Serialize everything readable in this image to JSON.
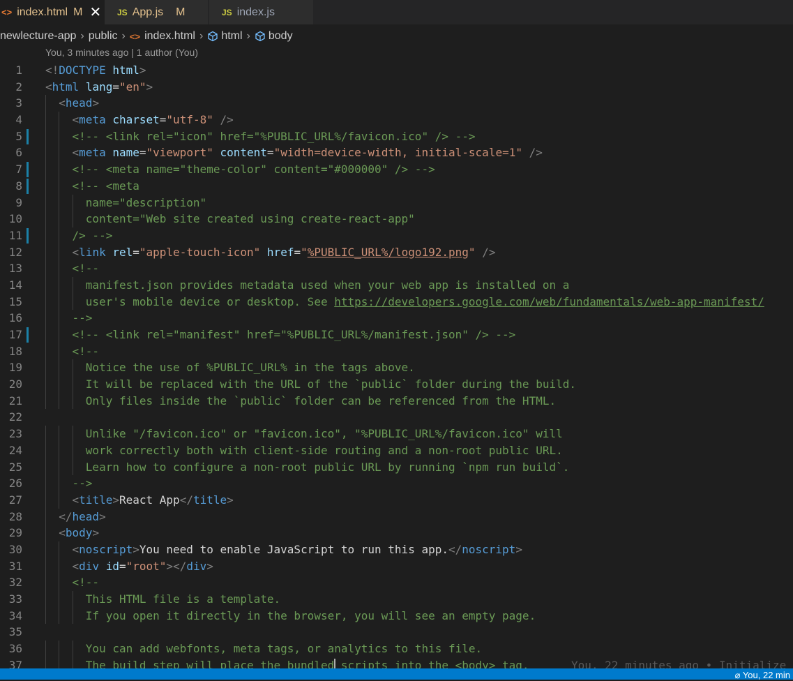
{
  "tabs": [
    {
      "label": "index.html",
      "status": "M",
      "icon": "html-file-icon"
    },
    {
      "label": "App.js",
      "status": "M",
      "icon": "js-file-icon"
    },
    {
      "label": "index.js",
      "status": "",
      "icon": "js-file-icon"
    }
  ],
  "tab_icon_text": {
    "html": "<>",
    "js": "JS"
  },
  "breadcrumb": [
    "newlecture-app",
    "public",
    "index.html",
    "html",
    "body"
  ],
  "codelens": "You, 3 minutes ago | 1 author (You)",
  "ghost_blame": "You, 22 minutes ago • Initialize",
  "status_bar": {
    "blame": "You, 22 min"
  },
  "lines": [
    {
      "n": "1",
      "code": "<!DOCTYPE html>"
    },
    {
      "n": "2",
      "code": "<html lang=\"en\">"
    },
    {
      "n": "3",
      "code": "  <head>"
    },
    {
      "n": "4",
      "code": "    <meta charset=\"utf-8\" />"
    },
    {
      "n": "5",
      "code": "    <!-- <link rel=\"icon\" href=\"%PUBLIC_URL%/favicon.ico\" /> -->",
      "changed": true
    },
    {
      "n": "6",
      "code": "    <meta name=\"viewport\" content=\"width=device-width, initial-scale=1\" />"
    },
    {
      "n": "7",
      "code": "    <!-- <meta name=\"theme-color\" content=\"#000000\" /> -->",
      "changed": true
    },
    {
      "n": "8",
      "code": "    <!-- <meta",
      "changed": true
    },
    {
      "n": "9",
      "code": "      name=\"description\""
    },
    {
      "n": "10",
      "code": "      content=\"Web site created using create-react-app\""
    },
    {
      "n": "11",
      "code": "    /> -->",
      "changed": true
    },
    {
      "n": "12",
      "code": "    <link rel=\"apple-touch-icon\" href=\"%PUBLIC_URL%/logo192.png\" />"
    },
    {
      "n": "13",
      "code": "    <!--"
    },
    {
      "n": "14",
      "code": "      manifest.json provides metadata used when your web app is installed on a"
    },
    {
      "n": "15",
      "code": "      user's mobile device or desktop. See https://developers.google.com/web/fundamentals/web-app-manifest/"
    },
    {
      "n": "16",
      "code": "    -->"
    },
    {
      "n": "17",
      "code": "    <!-- <link rel=\"manifest\" href=\"%PUBLIC_URL%/manifest.json\" /> -->",
      "changed": true
    },
    {
      "n": "18",
      "code": "    <!--"
    },
    {
      "n": "19",
      "code": "      Notice the use of %PUBLIC_URL% in the tags above."
    },
    {
      "n": "20",
      "code": "      It will be replaced with the URL of the `public` folder during the build."
    },
    {
      "n": "21",
      "code": "      Only files inside the `public` folder can be referenced from the HTML."
    },
    {
      "n": "22",
      "code": ""
    },
    {
      "n": "23",
      "code": "      Unlike \"/favicon.ico\" or \"favicon.ico\", \"%PUBLIC_URL%/favicon.ico\" will"
    },
    {
      "n": "24",
      "code": "      work correctly both with client-side routing and a non-root public URL."
    },
    {
      "n": "25",
      "code": "      Learn how to configure a non-root public URL by running `npm run build`."
    },
    {
      "n": "26",
      "code": "    -->"
    },
    {
      "n": "27",
      "code": "    <title>React App</title>"
    },
    {
      "n": "28",
      "code": "  </head>"
    },
    {
      "n": "29",
      "code": "  <body>"
    },
    {
      "n": "30",
      "code": "    <noscript>You need to enable JavaScript to run this app.</noscript>"
    },
    {
      "n": "31",
      "code": "    <div id=\"root\"></div>"
    },
    {
      "n": "32",
      "code": "    <!--"
    },
    {
      "n": "33",
      "code": "      This HTML file is a template."
    },
    {
      "n": "34",
      "code": "      If you open it directly in the browser, you will see an empty page."
    },
    {
      "n": "35",
      "code": ""
    },
    {
      "n": "36",
      "code": "      You can add webfonts, meta tags, or analytics to this file."
    },
    {
      "n": "37",
      "code": "      The build step will place the bundled scripts into the <body> tag.",
      "current": true
    }
  ]
}
